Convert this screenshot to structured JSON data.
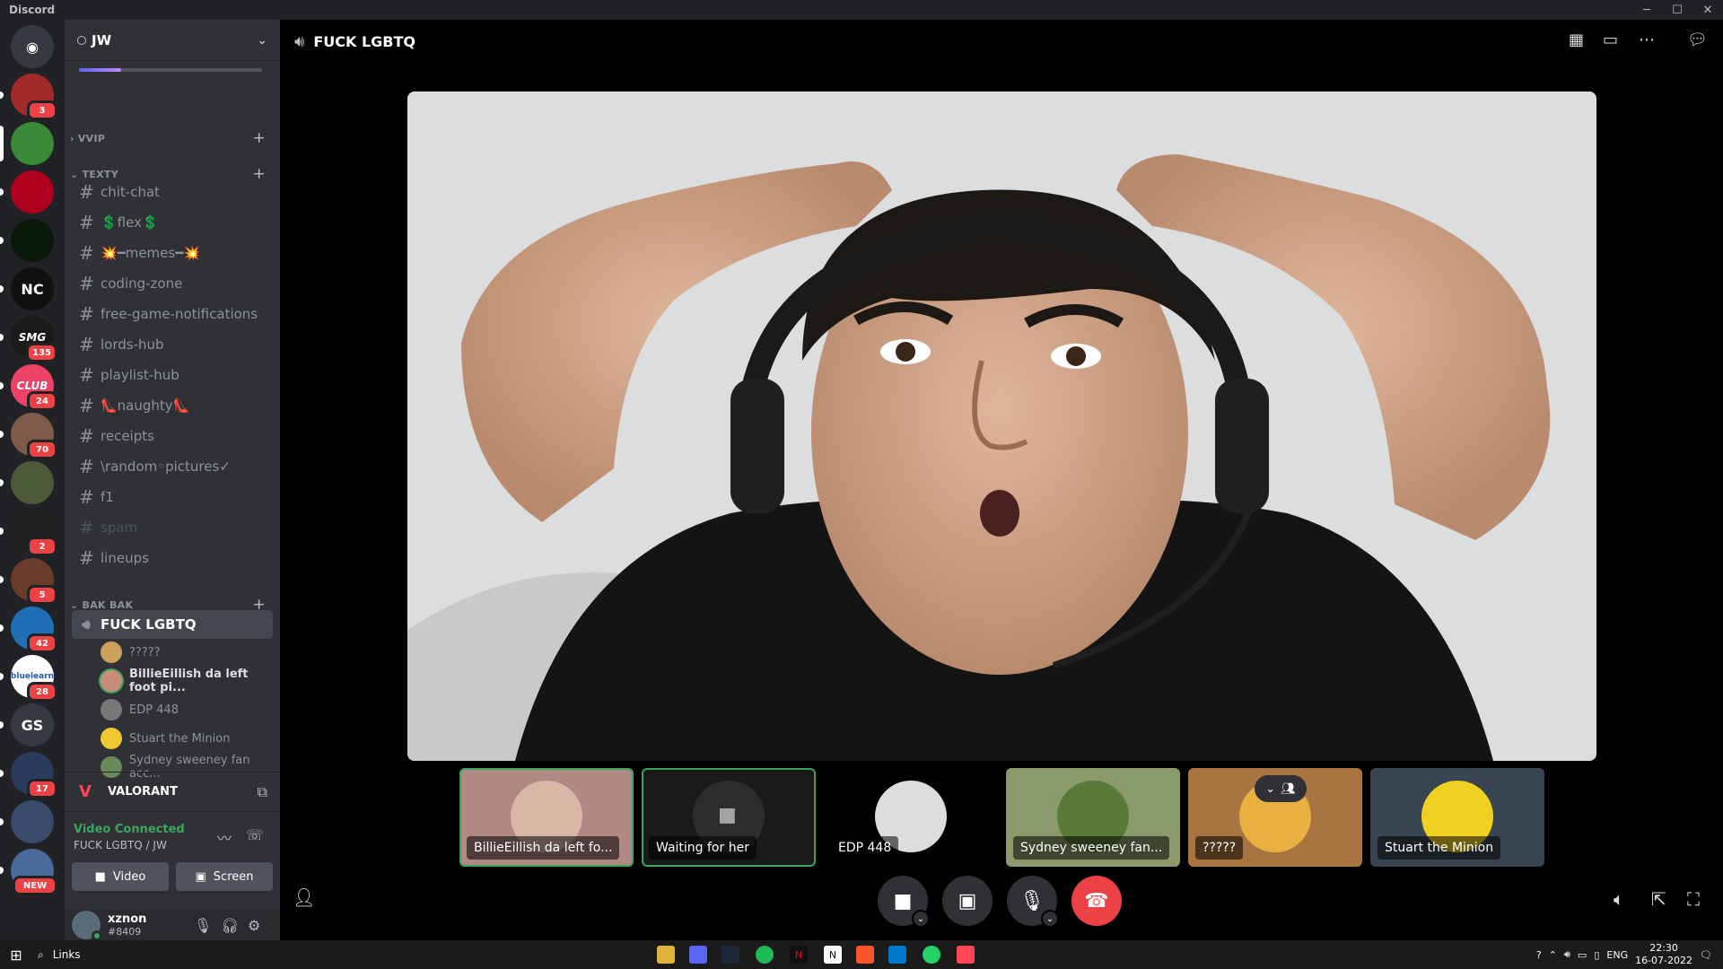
{
  "window": {
    "title": "Discord",
    "buttons": [
      "─",
      "☐",
      "✕"
    ]
  },
  "servers": [
    {
      "id": "home",
      "glyph": "◉",
      "color": "#36393f"
    },
    {
      "id": "s1",
      "glyph": "",
      "color": "#a12a2a",
      "badge": "3"
    },
    {
      "id": "s2",
      "glyph": "",
      "color": "#3a8a3a",
      "active": true
    },
    {
      "id": "s3",
      "glyph": "",
      "color": "#b0001e"
    },
    {
      "id": "s4",
      "glyph": "",
      "color": "#0a1a0a"
    },
    {
      "id": "s5",
      "glyph": "NC",
      "color": "#111"
    },
    {
      "id": "s6",
      "glyph": "SMG",
      "color": "#1a1a1a",
      "badge": "135"
    },
    {
      "id": "s7",
      "glyph": "CLUB",
      "color": "#ed4265",
      "badge": "24"
    },
    {
      "id": "s8",
      "glyph": "",
      "color": "#7d5a4a",
      "badge": "70"
    },
    {
      "id": "s9",
      "glyph": "",
      "color": "#4d5a3a"
    },
    {
      "id": "s10",
      "glyph": "",
      "color": "#222",
      "badge": "2"
    },
    {
      "id": "s11",
      "glyph": "",
      "color": "#6b3b2a",
      "badge": "5"
    },
    {
      "id": "s12",
      "glyph": "",
      "color": "#1e6fb5",
      "badge": "42"
    },
    {
      "id": "s13",
      "glyph": "bluelearn",
      "color": "#ffffff",
      "badge": "28"
    },
    {
      "id": "s14",
      "glyph": "GS",
      "color": "#36393f"
    },
    {
      "id": "s15",
      "glyph": "",
      "color": "#2a3a5a",
      "badge": "17"
    },
    {
      "id": "s16",
      "glyph": "",
      "color": "#3a4a6a"
    },
    {
      "id": "s17",
      "glyph": "",
      "color": "#4a6a9a",
      "badge": "NEW"
    }
  ],
  "sidebar": {
    "server_name": "JW",
    "boost_progress": 0.23,
    "categories": [
      {
        "name": "VVIP",
        "collapsed": true
      },
      {
        "name": "TEXTY"
      },
      {
        "name": "BAK BAK"
      }
    ],
    "text_channels": [
      "chit-chat",
      "💲flex💲",
      "💥━memes━💥",
      "coding-zone",
      "free-game-notifications",
      "lords-hub",
      "playlist-hub",
      "👠naughty👠",
      "receipts",
      "\\random◦pictures✓",
      "f1",
      "spam",
      "lineups"
    ],
    "voice_channel": "FUCK LGBTQ",
    "voice_users": [
      "?????",
      "BillieEillish da left foot pi...",
      "EDP 448",
      "Stuart the Minion",
      "Sydney sweeney fan acc..."
    ],
    "game": "VALORANT",
    "voice_status": "Video Connected",
    "voice_location": "FUCK LGBTQ / JW",
    "video_btn": "Video",
    "screen_btn": "Screen",
    "user": {
      "name": "xznon",
      "tag": "#8409"
    }
  },
  "main": {
    "channel_title": "FUCK LGBTQ",
    "tiles": [
      "BillieEillish da left fo...",
      "Waiting for her",
      "EDP 448",
      "Sydney sweeney fan...",
      "?????",
      "Stuart the Minion"
    ]
  },
  "taskbar": {
    "search": "Links",
    "lang": "ENG",
    "time": "22:30",
    "date": "16-07-2022"
  },
  "colors": {
    "accent": "#5865f2",
    "online": "#3ba55d",
    "danger": "#ed4245"
  }
}
